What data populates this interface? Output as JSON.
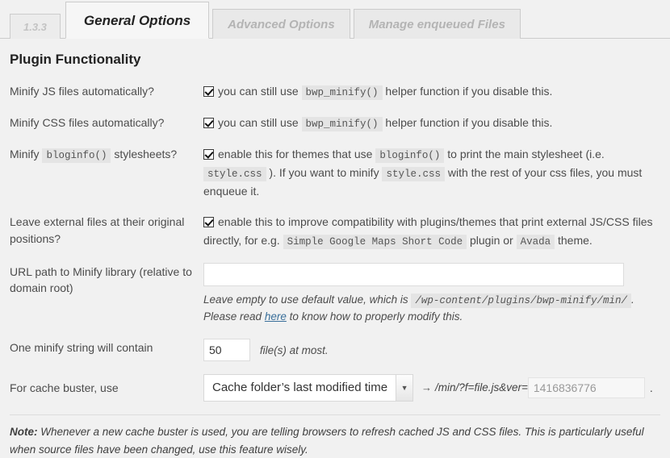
{
  "tabs": [
    {
      "label": "1.3.3",
      "state": "version"
    },
    {
      "label": "General Options",
      "state": "active"
    },
    {
      "label": "Advanced Options",
      "state": "inactive"
    },
    {
      "label": "Manage enqueued Files",
      "state": "inactive"
    }
  ],
  "section": {
    "title": "Plugin Functionality"
  },
  "rows": {
    "minify_js": {
      "label": "Minify JS files automatically?",
      "checked": true,
      "text_before": "you can still use",
      "code": "bwp_minify()",
      "text_after": "helper function if you disable this."
    },
    "minify_css": {
      "label": "Minify CSS files automatically?",
      "checked": true,
      "text_before": "you can still use",
      "code": "bwp_minify()",
      "text_after": "helper function if you disable this."
    },
    "minify_bloginfo": {
      "label_part1": "Minify",
      "label_code": "bloginfo()",
      "label_part2": "stylesheets?",
      "checked": true,
      "t1": "enable this for themes that use",
      "c1": "bloginfo()",
      "t2": "to print the main stylesheet (i.e.",
      "c2": "style.css",
      "t3": "). If you want to minify",
      "c3": "style.css",
      "t4": "with the rest of your css files, you must enqueue it."
    },
    "external_files": {
      "label": "Leave external files at their original positions?",
      "checked": true,
      "t1": "enable this to improve compatibility with plugins/themes that print external JS/CSS files directly, for e.g.",
      "c1": "Simple Google Maps Short Code",
      "t2": "plugin or",
      "c2": "Avada",
      "t3": "theme."
    },
    "minify_url": {
      "label": "URL path to Minify library (relative to domain root)",
      "value": "",
      "placeholder": "",
      "hint_t1": "Leave empty to use default value, which is",
      "hint_code": "/wp-content/plugins/bwp-minify/min/",
      "hint_t2": ".",
      "hint_t3": "Please read",
      "hint_link": "here",
      "hint_t4": "to know how to properly modify this."
    },
    "minify_string": {
      "label": "One minify string will contain",
      "value": "50",
      "suffix": "file(s) at most."
    },
    "cache_buster": {
      "label": "For cache buster, use",
      "selected": "Cache folder’s last modified time",
      "options": [
        "Cache folder’s last modified time"
      ],
      "arrow_icon": "→",
      "expression": "/min/?f=file.js&ver=",
      "version_value": "1416836776",
      "trailing": "."
    }
  },
  "footer_note": {
    "prefix": "Note:",
    "text": "Whenever a new cache buster is used, you are telling browsers to refresh cached JS and CSS files. This is particularly useful when source files have been changed, use this feature wisely."
  }
}
